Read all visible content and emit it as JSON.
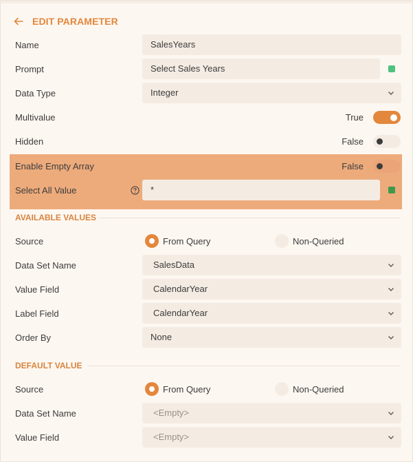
{
  "header": {
    "title": "EDIT PARAMETER"
  },
  "fields": {
    "name": {
      "label": "Name",
      "value": "SalesYears"
    },
    "prompt": {
      "label": "Prompt",
      "value": "Select Sales Years"
    },
    "data_type": {
      "label": "Data Type",
      "value": "Integer"
    },
    "multivalue": {
      "label": "Multivalue",
      "state": "True",
      "on": true
    },
    "hidden": {
      "label": "Hidden",
      "state": "False",
      "on": false
    },
    "enable_empty_array": {
      "label": "Enable Empty Array",
      "state": "False",
      "on": false
    },
    "select_all_value": {
      "label": "Select All Value",
      "value": "*"
    }
  },
  "available_values": {
    "title": "AVAILABLE VALUES",
    "source": {
      "label": "Source",
      "options": [
        "From Query",
        "Non-Queried"
      ],
      "selected": "From Query"
    },
    "data_set_name": {
      "label": "Data Set Name",
      "value": "SalesData"
    },
    "value_field": {
      "label": "Value Field",
      "value": "CalendarYear"
    },
    "label_field": {
      "label": "Label Field",
      "value": "CalendarYear"
    },
    "order_by": {
      "label": "Order By",
      "value": "None"
    }
  },
  "default_value": {
    "title": "DEFAULT VALUE",
    "source": {
      "label": "Source",
      "options": [
        "From Query",
        "Non-Queried"
      ],
      "selected": "From Query"
    },
    "data_set_name": {
      "label": "Data Set Name",
      "value": "<Empty>"
    },
    "value_field": {
      "label": "Value Field",
      "value": "<Empty>"
    }
  },
  "colors": {
    "accent": "#e3873c",
    "highlight": "#edab7c",
    "valid_indicator": "#4fc27f",
    "valid_indicator_dark": "#3e9a4a"
  },
  "icons": {
    "back": "arrow-left-icon",
    "dropdown": "chevron-down-icon",
    "help": "question-circle-icon"
  }
}
